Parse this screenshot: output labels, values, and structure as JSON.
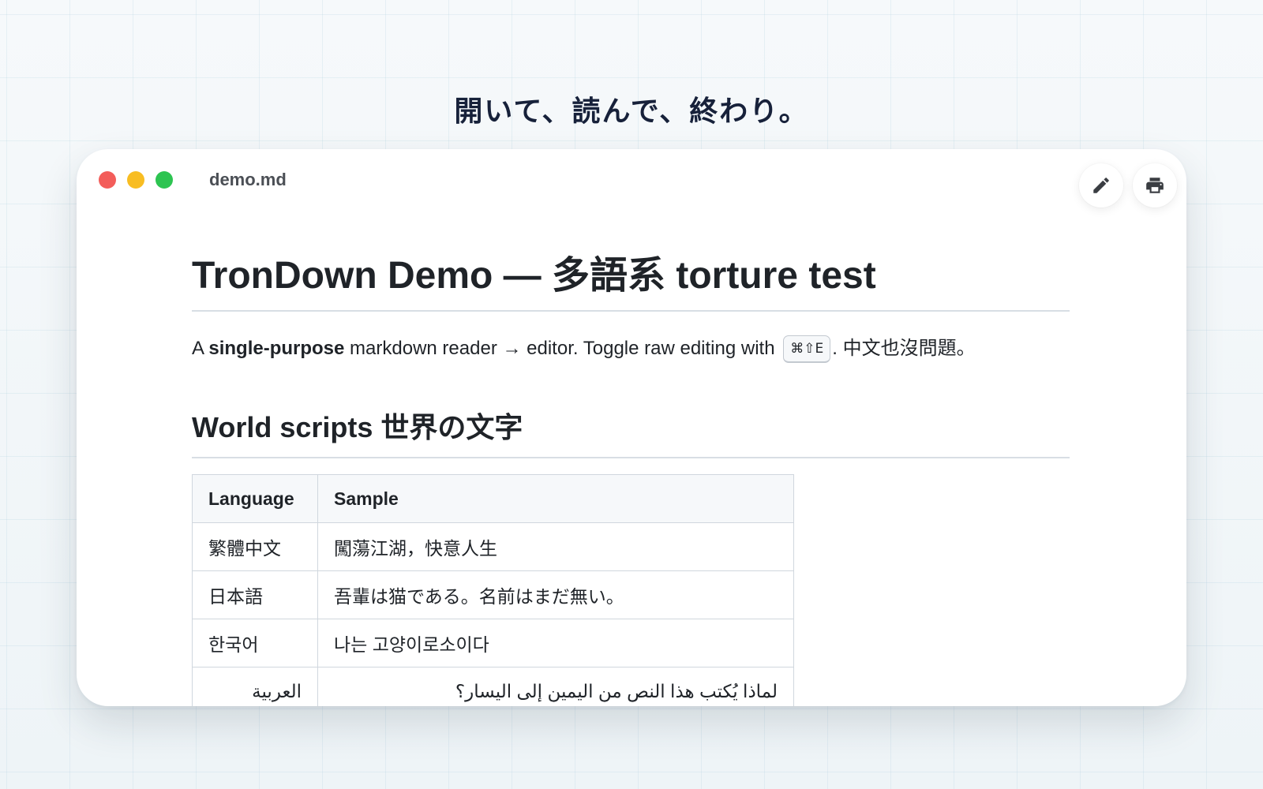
{
  "tagline": "開いて、読んで、終わり。",
  "window": {
    "filename": "demo.md",
    "toolbar": {
      "edit_icon": "pencil-icon",
      "print_icon": "printer-icon"
    }
  },
  "document": {
    "title": "TronDown Demo — 多語系 torture test",
    "intro": {
      "prefix": "A ",
      "bold": "single-purpose",
      "middle": " markdown reader → editor. Toggle raw editing with ",
      "kbd": "⌘⇧E",
      "suffix": ". 中文也沒問題。"
    },
    "section_heading": "World scripts 世界の文字",
    "table": {
      "headers": [
        "Language",
        "Sample"
      ],
      "rows": [
        {
          "language": "繁體中文",
          "sample": "闖蕩江湖，快意人生",
          "rtl": false
        },
        {
          "language": "日本語",
          "sample": "吾輩は猫である。名前はまだ無い。",
          "rtl": false
        },
        {
          "language": "한국어",
          "sample": "나는 고양이로소이다",
          "rtl": false
        },
        {
          "language": "العربية",
          "sample": "لماذا يُكتب هذا النص من اليمين إلى اليسار؟",
          "rtl": true
        }
      ]
    }
  },
  "colors": {
    "close": "#f35d5a",
    "minimize": "#f8bd22",
    "zoom": "#2dc451"
  }
}
